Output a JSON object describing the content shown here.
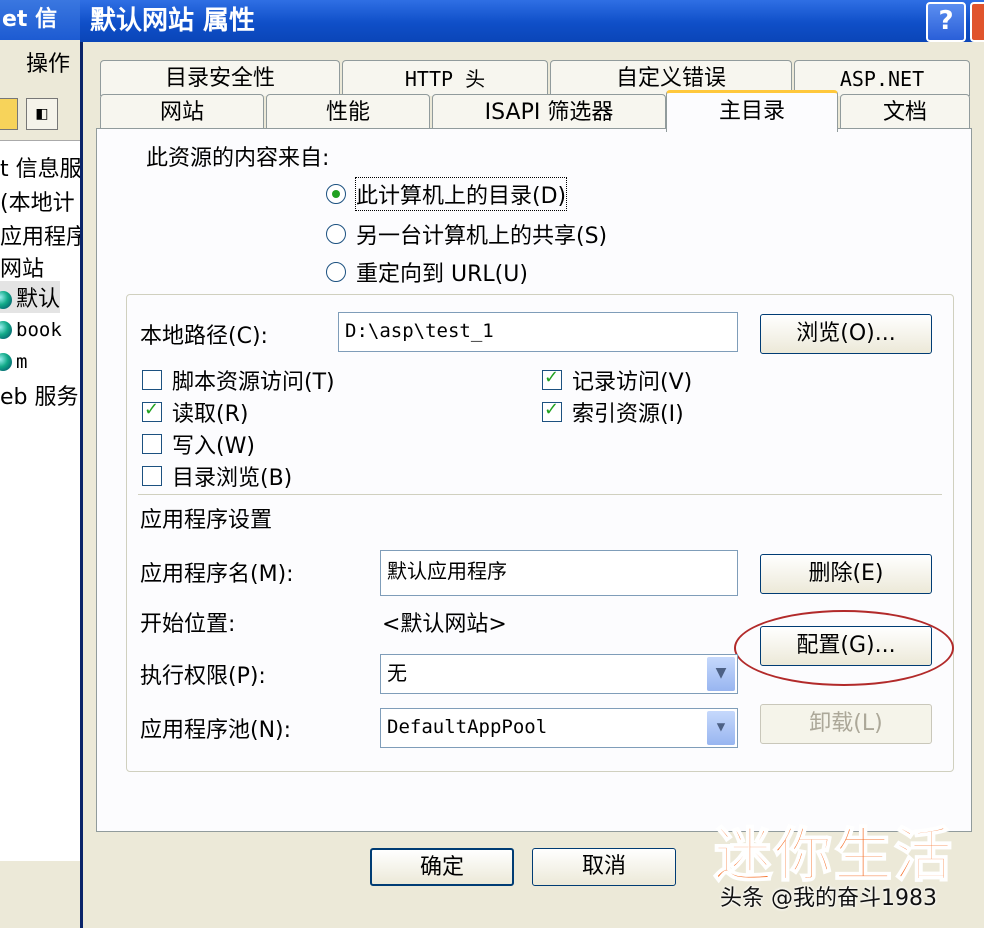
{
  "background_window": {
    "title": "et 信",
    "menu_action": "操作",
    "tree": [
      {
        "label": "t 信息服",
        "icon": ""
      },
      {
        "label": "(本地计",
        "icon": ""
      },
      {
        "label": "应用程序",
        "icon": ""
      },
      {
        "label": "网站",
        "icon": ""
      },
      {
        "label": "默认",
        "icon": "globe-icon"
      },
      {
        "label": "book",
        "icon": "globe-icon"
      },
      {
        "label": "m",
        "icon": "globe-icon"
      },
      {
        "label": "eb 服务",
        "icon": ""
      }
    ]
  },
  "dialog": {
    "title": "默认网站 属性",
    "help": "?",
    "tabs_row1": [
      "目录安全性",
      "HTTP 头",
      "自定义错误",
      "ASP.NET"
    ],
    "tabs_row2": [
      "网站",
      "性能",
      "ISAPI 筛选器",
      "主目录",
      "文档"
    ],
    "active_tab": "主目录",
    "source_label": "此资源的内容来自:",
    "radios": [
      {
        "label": "此计算机上的目录(D)",
        "checked": true
      },
      {
        "label": "另一台计算机上的共享(S)",
        "checked": false
      },
      {
        "label": "重定向到 URL(U)",
        "checked": false
      }
    ],
    "local_path_label": "本地路径(C):",
    "local_path_value": "D:\\asp\\test_1",
    "browse_button": "浏览(O)...",
    "checkboxes_left": [
      {
        "label": "脚本资源访问(T)",
        "checked": false
      },
      {
        "label": "读取(R)",
        "checked": true
      },
      {
        "label": "写入(W)",
        "checked": false
      },
      {
        "label": "目录浏览(B)",
        "checked": false
      }
    ],
    "checkboxes_right": [
      {
        "label": "记录访问(V)",
        "checked": true
      },
      {
        "label": "索引资源(I)",
        "checked": true
      }
    ],
    "app_settings_label": "应用程序设置",
    "app_name_label": "应用程序名(M):",
    "app_name_value": "默认应用程序",
    "remove_button": "删除(E)",
    "start_point_label": "开始位置:",
    "start_point_value": "<默认网站>",
    "config_button": "配置(G)...",
    "exec_perm_label": "执行权限(P):",
    "exec_perm_value": "无",
    "app_pool_label": "应用程序池(N):",
    "app_pool_value": "DefaultAppPool",
    "unload_button": "卸载(L)",
    "ok_button": "确定",
    "cancel_button": "取消"
  },
  "watermark": {
    "text": "迷你生活",
    "sub": "头条 @我的奋斗1983"
  },
  "colors": {
    "title_blue": "#0f4fc8",
    "dialog_bg": "#ece9d8",
    "tab_highlight": "#ffc83c",
    "check_green": "#21a121",
    "circle_red": "#b22a2a",
    "watermark_orange": "#f5681c"
  }
}
